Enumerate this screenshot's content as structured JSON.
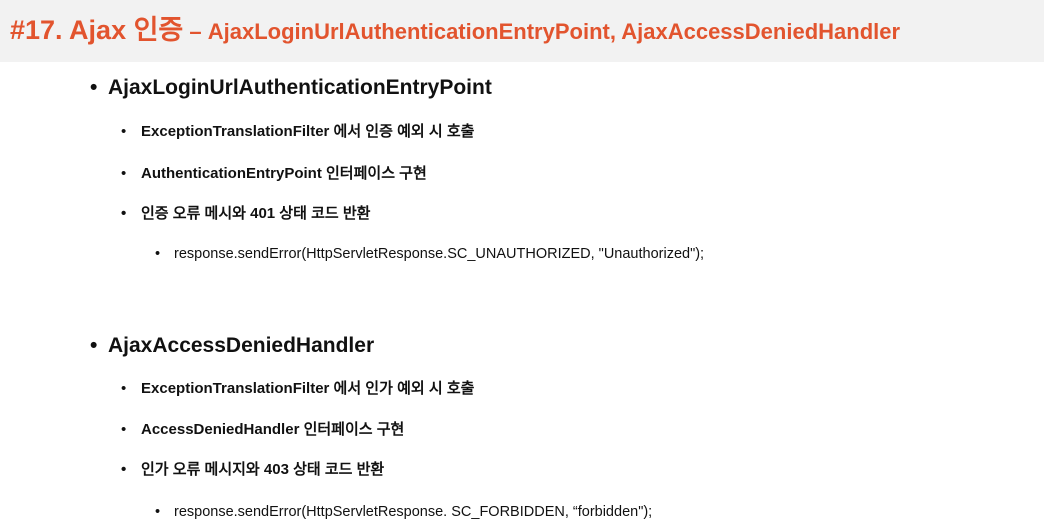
{
  "slide": {
    "title_main": "#17. Ajax 인증",
    "title_sub": " – AjaxLoginUrlAuthenticationEntryPoint, AjaxAccessDeniedHandler",
    "bullet_char": "•"
  },
  "section1": {
    "heading": "AjaxLoginUrlAuthenticationEntryPoint",
    "item1_bold": "ExceptionTranslationFilter",
    "item1_rest": " 에서 인증 예외 시 호출",
    "item2_bold": "AuthenticationEntryPoint",
    "item2_rest": " 인터페이스 구현",
    "item3": "인증 오류 메시와 401 상태 코드 반환",
    "code": "response.sendError(HttpServletResponse.SC_UNAUTHORIZED, \"Unauthorized\");"
  },
  "section2": {
    "heading": "AjaxAccessDeniedHandler",
    "item1_bold": "ExceptionTranslationFilter",
    "item1_rest": " 에서 인가 예외 시 호출",
    "item2_bold": "AccessDeniedHandler",
    "item2_rest": " 인터페이스 구현",
    "item3": "인가 오류 메시지와 403 상태 코드 반환",
    "code": "response.sendError(HttpServletResponse. SC_FORBIDDEN, “forbidden\");"
  }
}
